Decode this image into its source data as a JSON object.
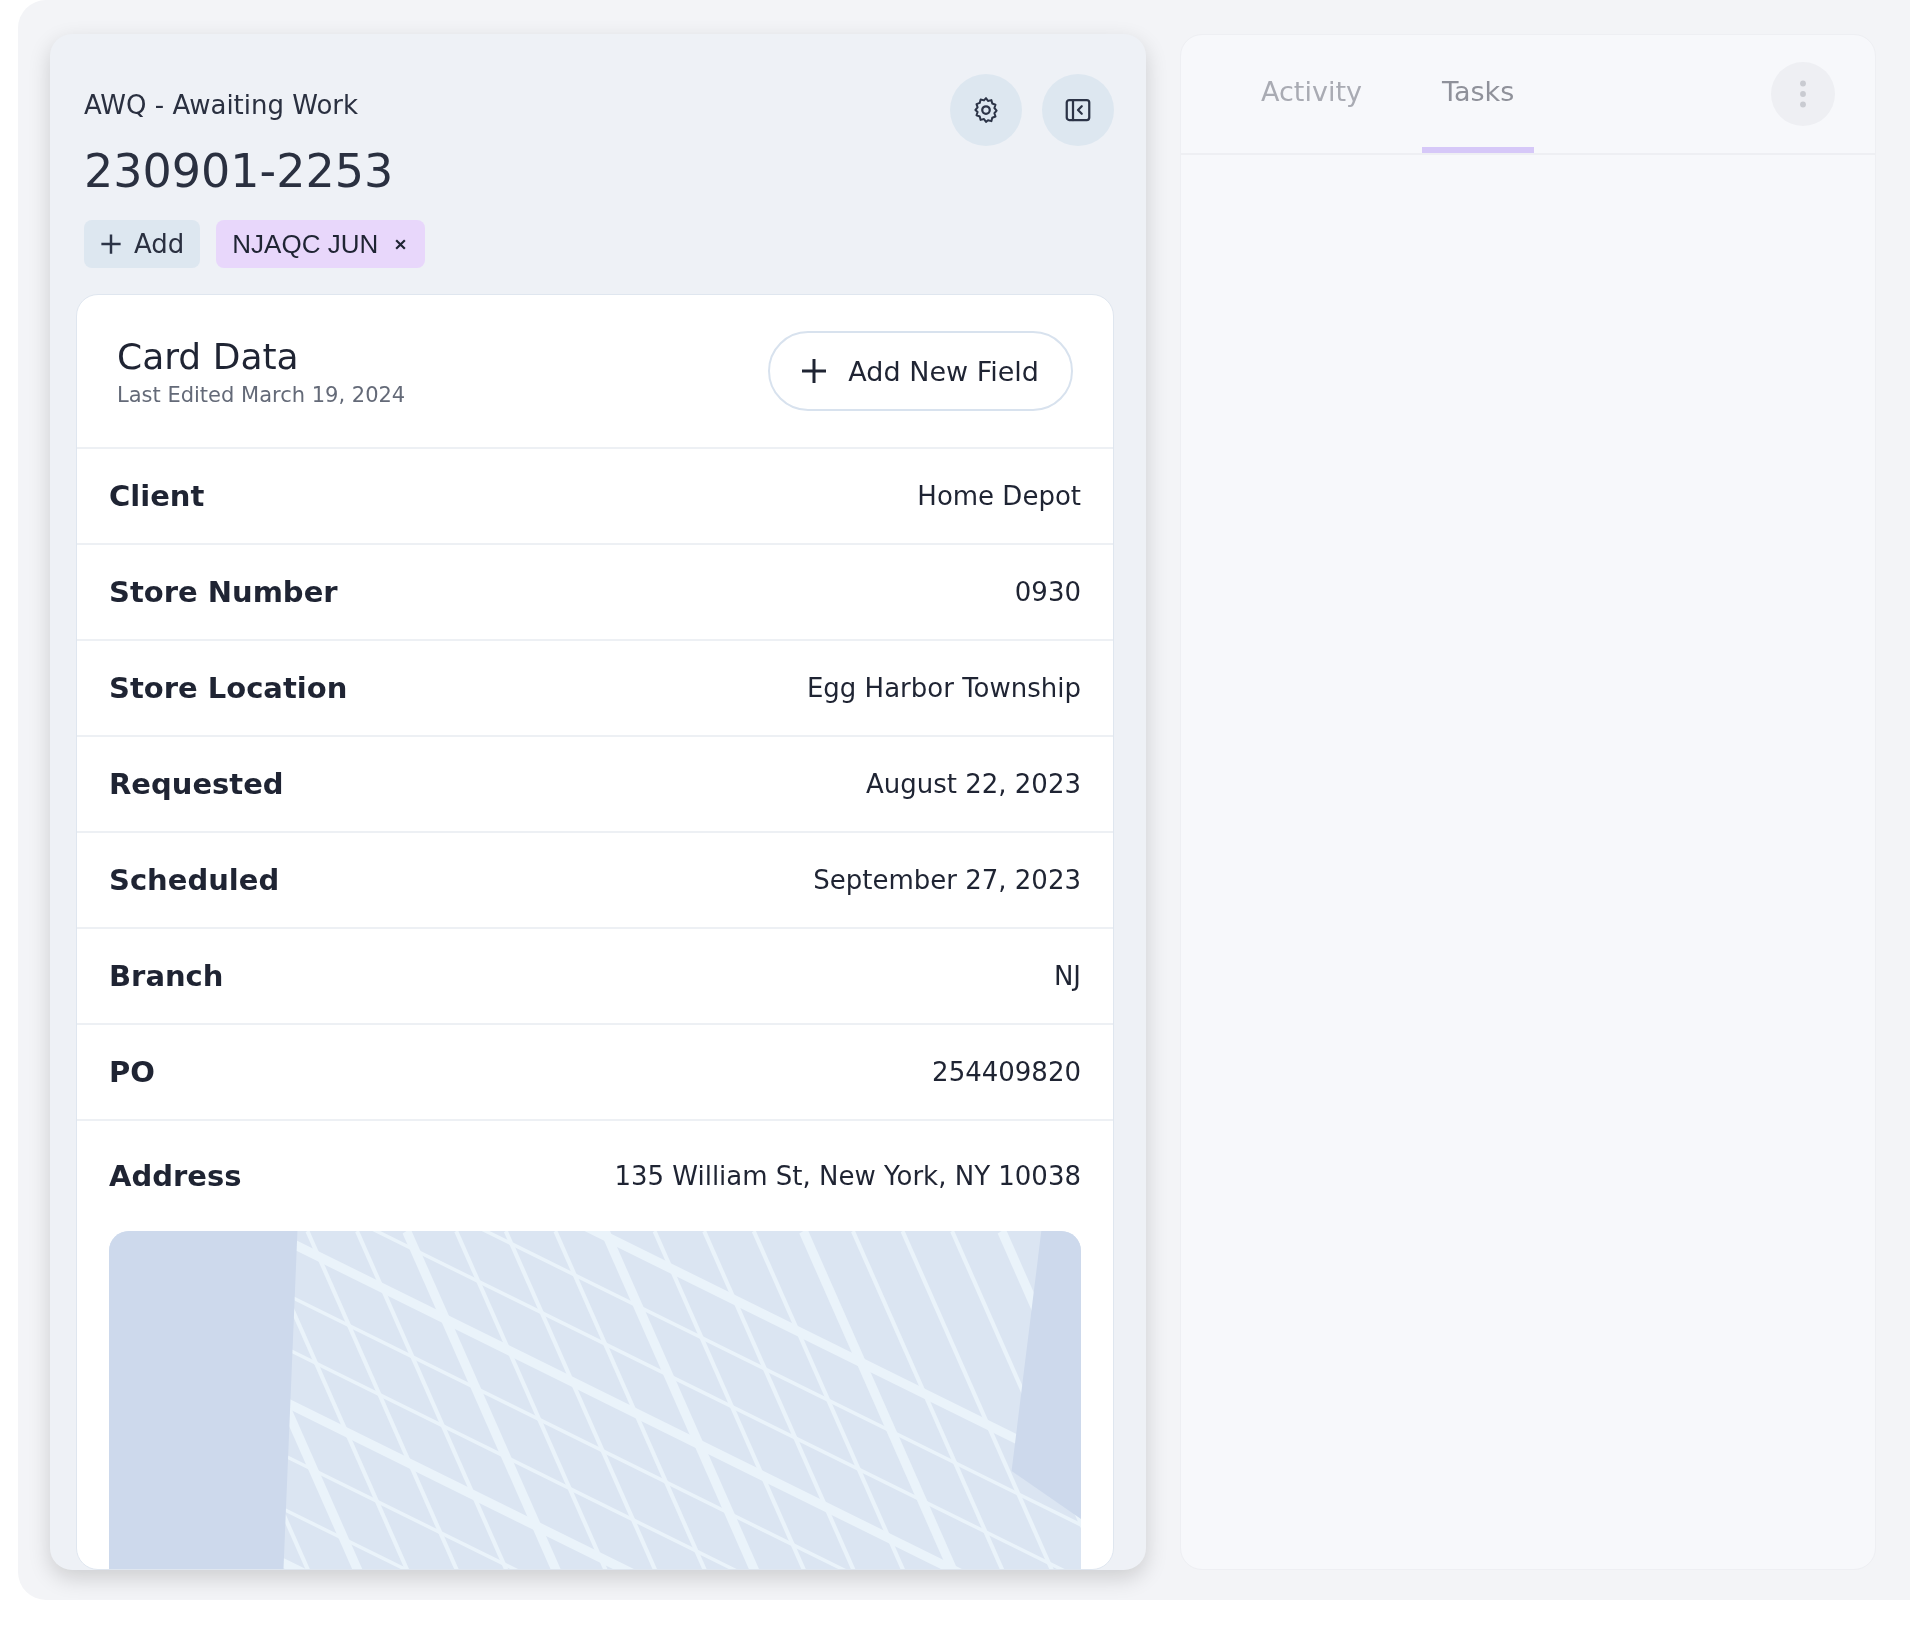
{
  "card_panel": {
    "status": "AWQ - Awaiting Work",
    "number": "230901-2253",
    "add_tag_label": "Add",
    "tags": [
      {
        "label": "NJAQC JUN",
        "color": "#e8d7fb"
      }
    ]
  },
  "card_data": {
    "title": "Card Data",
    "last_edited": "Last Edited March 19, 2024",
    "add_field_label": "Add New Field",
    "fields": [
      {
        "label": "Client",
        "value": "Home Depot"
      },
      {
        "label": "Store Number",
        "value": "0930"
      },
      {
        "label": "Store Location",
        "value": "Egg Harbor Township"
      },
      {
        "label": "Requested",
        "value": "August 22, 2023"
      },
      {
        "label": "Scheduled",
        "value": "September 27, 2023"
      },
      {
        "label": "Branch",
        "value": "NJ"
      },
      {
        "label": "PO",
        "value": "254409820"
      },
      {
        "label": "Address",
        "value": "135 William St, New York, NY 10038",
        "kind": "map"
      }
    ]
  },
  "side_panel": {
    "tabs": [
      {
        "label": "Activity",
        "selected": false
      },
      {
        "label": "Tasks",
        "selected": true
      }
    ]
  }
}
